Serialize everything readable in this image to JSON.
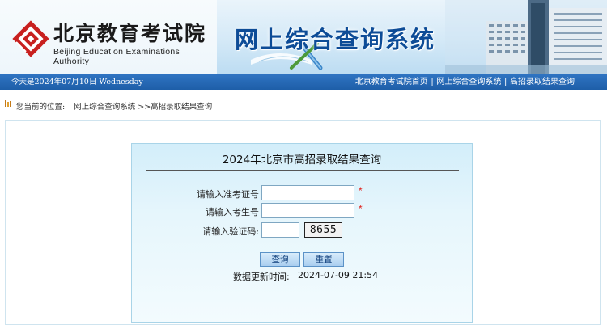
{
  "header": {
    "org_name": "北京教育考试院",
    "org_name_en": "Beijing Education Examinations Authority",
    "system_title": "网上综合查询系统"
  },
  "navbar": {
    "date_text": "今天是2024年07月10日 Wednesday",
    "links": [
      "北京教育考试院首页",
      "网上综合查询系统",
      "高招录取结果查询"
    ],
    "separator": "|"
  },
  "breadcrumb": {
    "prefix": "您当前的位置:",
    "path": "网上综合查询系统 >>高招录取结果查询"
  },
  "form": {
    "title": "2024年北京市高招录取结果查询",
    "exam_id_label": "请输入准考证号",
    "exam_id_value": "",
    "student_no_label": "请输入考生号",
    "student_no_value": "",
    "captcha_label": "请输入验证码:",
    "captcha_value": "",
    "captcha_image_text": "8655",
    "required_mark": "*",
    "query_button": "查询",
    "reset_button": "重置",
    "update_label": "数据更新时间:",
    "update_time": "2024-07-09 21:54"
  },
  "colors": {
    "nav_blue": "#1e5ea8",
    "title_blue": "#0d4c97",
    "logo_red": "#c8201f",
    "required_red": "#e0201a"
  }
}
